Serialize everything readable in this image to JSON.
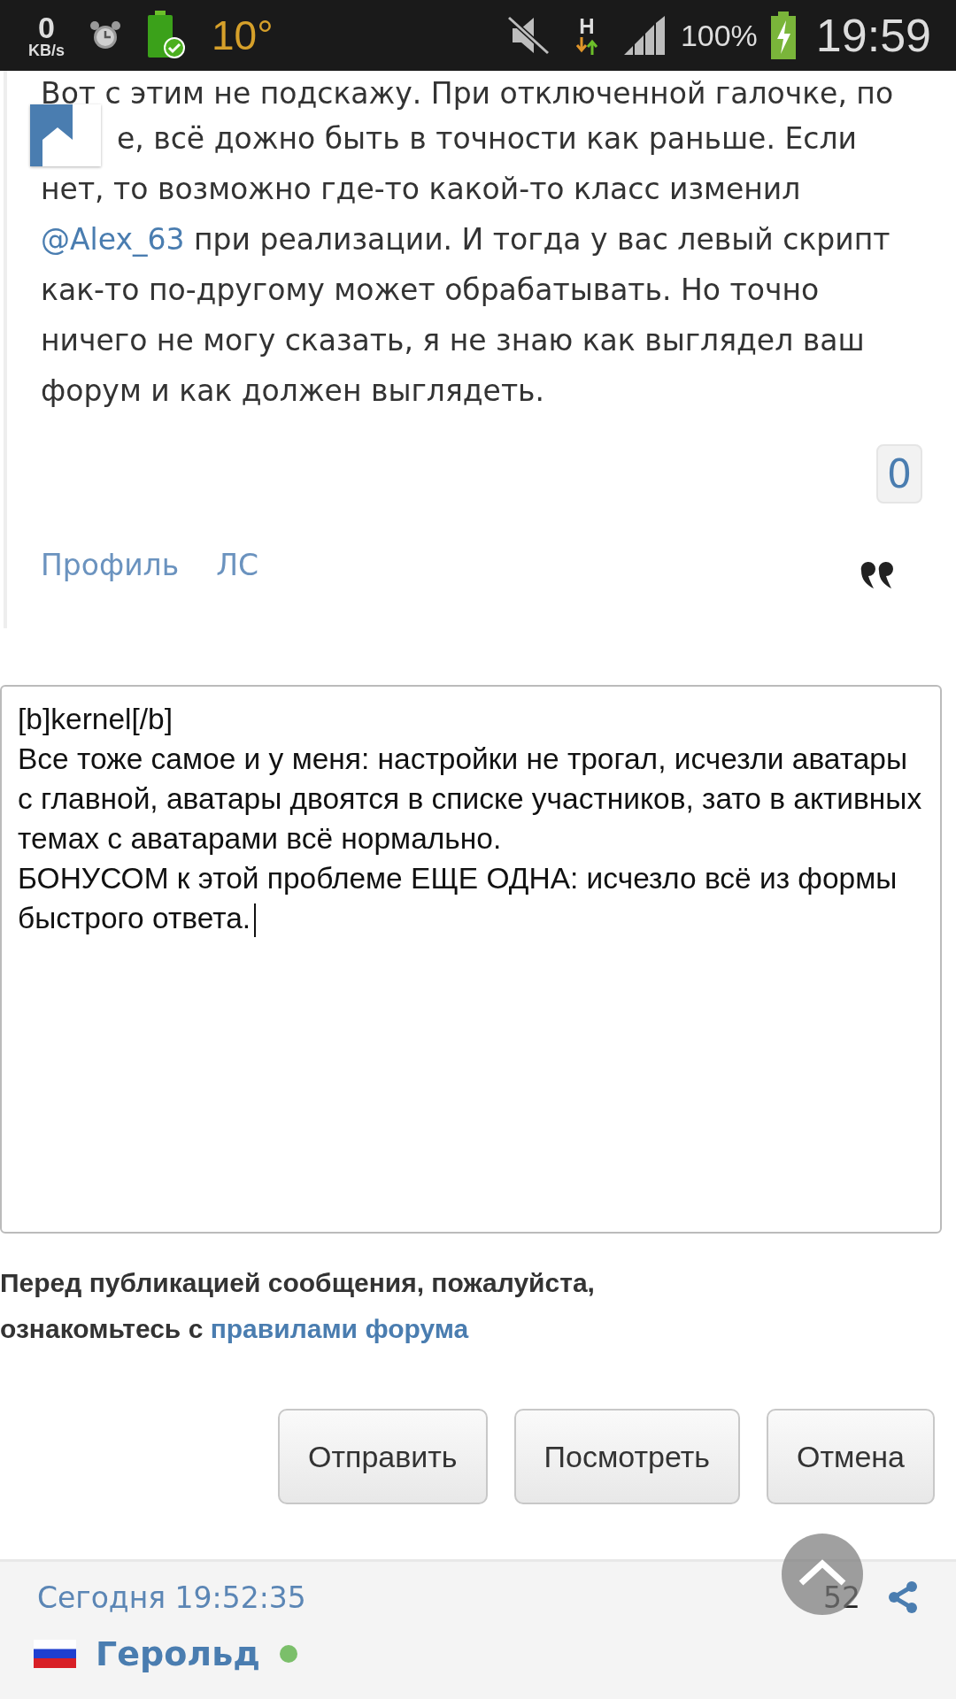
{
  "status_bar": {
    "speed_value": "0",
    "speed_unit": "KB/s",
    "temperature": "10°",
    "network": "H",
    "battery": "100%",
    "time": "19:59"
  },
  "post": {
    "lines": [
      {
        "text": "Вот с этим не подскажу. При отключенной галочке, по",
        "indented": false
      },
      {
        "text": "е, всё дожно быть в точности как раньше. Если",
        "indented": true
      },
      {
        "text": "нет, то возможно где-то какой-то класс изменил",
        "indented": false
      },
      {
        "link": "@Alex_63",
        "text": " при реализации. И тогда у вас левый скрипт",
        "indented": false
      },
      {
        "text": "как-то по-другому может обрабатывать. Но точно",
        "indented": false
      },
      {
        "text": "ничего не могу сказать, я не знаю как выглядел ваш",
        "indented": false
      },
      {
        "text": "форум и как должен выглядеть.",
        "indented": false
      }
    ],
    "vote_count": "0",
    "links": [
      "Профиль",
      "ЛС"
    ]
  },
  "reply": {
    "value": "[b]kernel[/b]\nВсе тоже самое и у меня: настройки не трогал, исчезли аватары с главной, аватары двоятся в списке участников, зато в активных темах с аватарами всё нормально.\nБОНУСОМ к этой проблеме ЕЩЕ ОДНА: исчезло всё из формы быстрого ответа."
  },
  "notice": {
    "text": "Перед публикацией сообщения, пожалуйста, ознакомьтесь с ",
    "link": "правилами форума"
  },
  "buttons": [
    "Отправить",
    "Посмотреть",
    "Отмена"
  ],
  "next_post": {
    "date": "Сегодня 19:52:35",
    "number": "52",
    "author": "Герольд",
    "online": true
  }
}
